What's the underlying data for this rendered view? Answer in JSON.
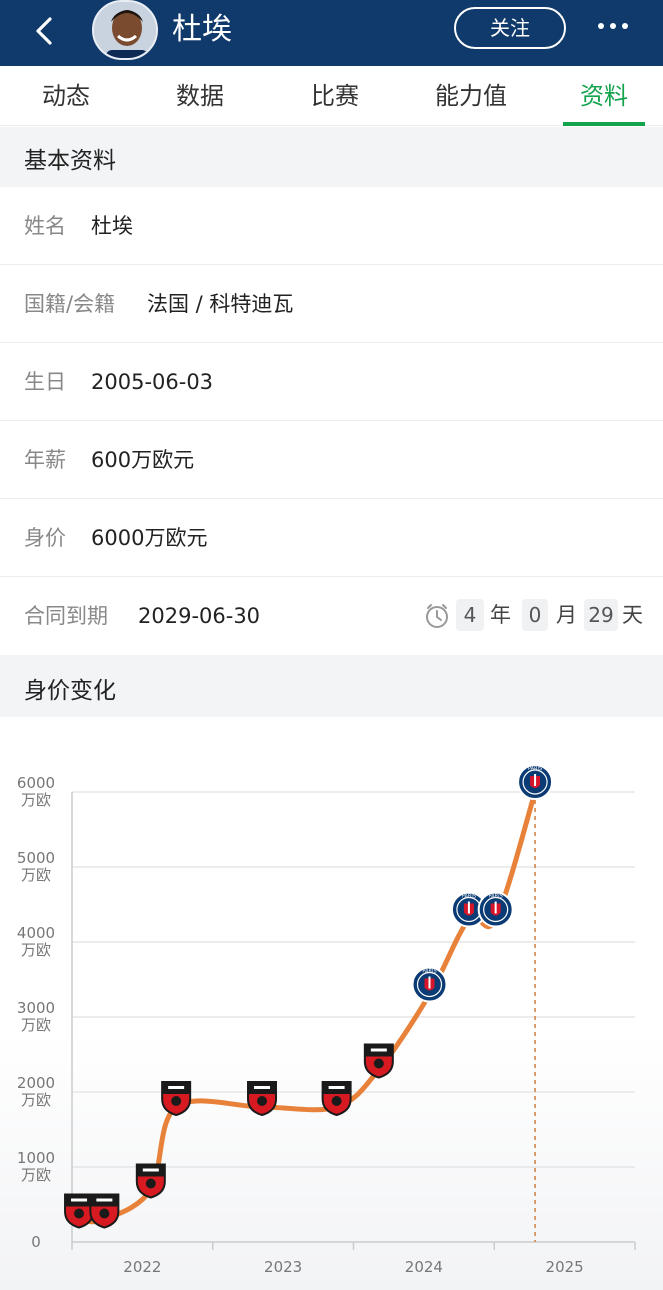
{
  "header": {
    "name": "杜埃",
    "follow_label": "关注",
    "colors": {
      "bg": "#0f3a6b",
      "accent": "#12a34d"
    }
  },
  "tabs": [
    {
      "label": "动态"
    },
    {
      "label": "数据"
    },
    {
      "label": "比赛"
    },
    {
      "label": "能力值"
    },
    {
      "label": "资料",
      "active": true
    }
  ],
  "basic": {
    "title": "基本资料",
    "rows": [
      {
        "label": "姓名",
        "value": "杜埃"
      },
      {
        "label": "国籍/会籍",
        "value": "法国 / 科特迪瓦"
      },
      {
        "label": "生日",
        "value": "2005-06-03"
      },
      {
        "label": "年薪",
        "value": "600万欧元"
      },
      {
        "label": "身价",
        "value": "6000万欧元"
      },
      {
        "label": "合同到期",
        "value": "2029-06-30"
      }
    ],
    "countdown": {
      "years": "4",
      "year_unit": "年",
      "months": "0",
      "month_unit": "月",
      "days": "29",
      "day_unit": "天",
      "icon": "clock-icon"
    }
  },
  "chart_section": {
    "title": "身价变化"
  },
  "chart_data": {
    "type": "line",
    "title": "",
    "xlabel": "",
    "ylabel": "",
    "x_ticks": [
      "2022",
      "2023",
      "2024",
      "2025"
    ],
    "y_ticks": [
      {
        "value": 0,
        "label": "0"
      },
      {
        "value": 1000,
        "label": "1000\n万欧"
      },
      {
        "value": 2000,
        "label": "2000\n万欧"
      },
      {
        "value": 3000,
        "label": "3000\n万欧"
      },
      {
        "value": 4000,
        "label": "4000\n万欧"
      },
      {
        "value": 5000,
        "label": "5000\n万欧"
      },
      {
        "value": 6000,
        "label": "6000\n万欧"
      }
    ],
    "ylim": [
      0,
      6000
    ],
    "xlim": [
      2021.5,
      2025.5
    ],
    "grid": true,
    "line_color": "#e8823a",
    "series": [
      {
        "points": [
          {
            "x": 2021.55,
            "y": 300,
            "club": "rennes"
          },
          {
            "x": 2021.73,
            "y": 300,
            "club": "rennes"
          },
          {
            "x": 2022.06,
            "y": 700,
            "club": "rennes"
          },
          {
            "x": 2022.24,
            "y": 1800,
            "club": "rennes"
          },
          {
            "x": 2022.85,
            "y": 1800,
            "club": "rennes"
          },
          {
            "x": 2023.38,
            "y": 1800,
            "club": "rennes"
          },
          {
            "x": 2023.68,
            "y": 2300,
            "club": "rennes"
          },
          {
            "x": 2024.04,
            "y": 3300,
            "club": "psg"
          },
          {
            "x": 2024.32,
            "y": 4300,
            "club": "psg"
          },
          {
            "x": 2024.51,
            "y": 4300,
            "club": "psg"
          },
          {
            "x": 2024.79,
            "y": 6000,
            "club": "psg"
          }
        ]
      }
    ],
    "current_marker_x": 2024.79,
    "clubs": {
      "rennes": "Rennes crest",
      "psg": "PSG crest"
    }
  }
}
